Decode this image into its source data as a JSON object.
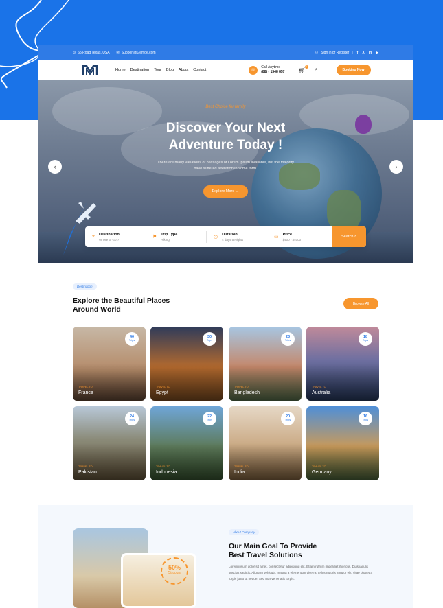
{
  "topbar": {
    "address": "65 Road Texas, USA",
    "email": "Support@Gemoe.com",
    "signin": "Sign in or Register",
    "social": [
      "f",
      "X",
      "in",
      "▶"
    ]
  },
  "nav": {
    "menu": [
      "Home",
      "Destination",
      "Tour",
      "Blog",
      "About",
      "Contact"
    ],
    "call_label": "Call Anytime",
    "call_number": "(88) - 1548 857",
    "cart_count": "0",
    "booking_label": "Booking Now"
  },
  "hero": {
    "tag": "Best Choice for family",
    "title_line1": "Discover Your Next",
    "title_line2": "Adventure Today !",
    "description": "There are many variations of passages of Lorem Ipsum available, but the majority have suffered alteration in some form.",
    "button": "Explore More →"
  },
  "search": {
    "fields": [
      {
        "label": "Destination",
        "value": "Where to Go ?"
      },
      {
        "label": "Trip Type",
        "value": "Hiking"
      },
      {
        "label": "Duration",
        "value": "4 days 5 Nights"
      },
      {
        "label": "Price",
        "value": "$400 - $4000"
      }
    ],
    "button": "Search"
  },
  "destinations": {
    "badge": "Destination",
    "title_line1": "Explore the Beautiful Places",
    "title_line2": "Around World",
    "browse": "Browse All",
    "travel_to": "TRAVEL TO",
    "trips_label": "Trips",
    "items": [
      {
        "country": "France",
        "trips": "40"
      },
      {
        "country": "Egypt",
        "trips": "30"
      },
      {
        "country": "Bangladesh",
        "trips": "23"
      },
      {
        "country": "Australia",
        "trips": "18"
      },
      {
        "country": "Pakistan",
        "trips": "24"
      },
      {
        "country": "Indonesia",
        "trips": "22"
      },
      {
        "country": "India",
        "trips": "20"
      },
      {
        "country": "Germany",
        "trips": "16"
      }
    ]
  },
  "about": {
    "badge": "About Company",
    "title_line1": "Our Main Goal To Provide",
    "title_line2": "Best Travel Solutions",
    "discount_value": "50%",
    "discount_label": "Discount",
    "text": "Lorem ipsum dolor sit amet, consectetur adipiscing elit. Etiam rutrum imperdiet rhoncus. Duis iaculis suscipit sagittis. Aliquam vehicula, magna a elementum viverra, tellus mauris tempor elit, vitae pharetra turpis justo ut neque. Sed non venenatis turpis."
  },
  "colors": {
    "primary_blue": "#1a73e8",
    "accent_orange": "#f7962e"
  }
}
